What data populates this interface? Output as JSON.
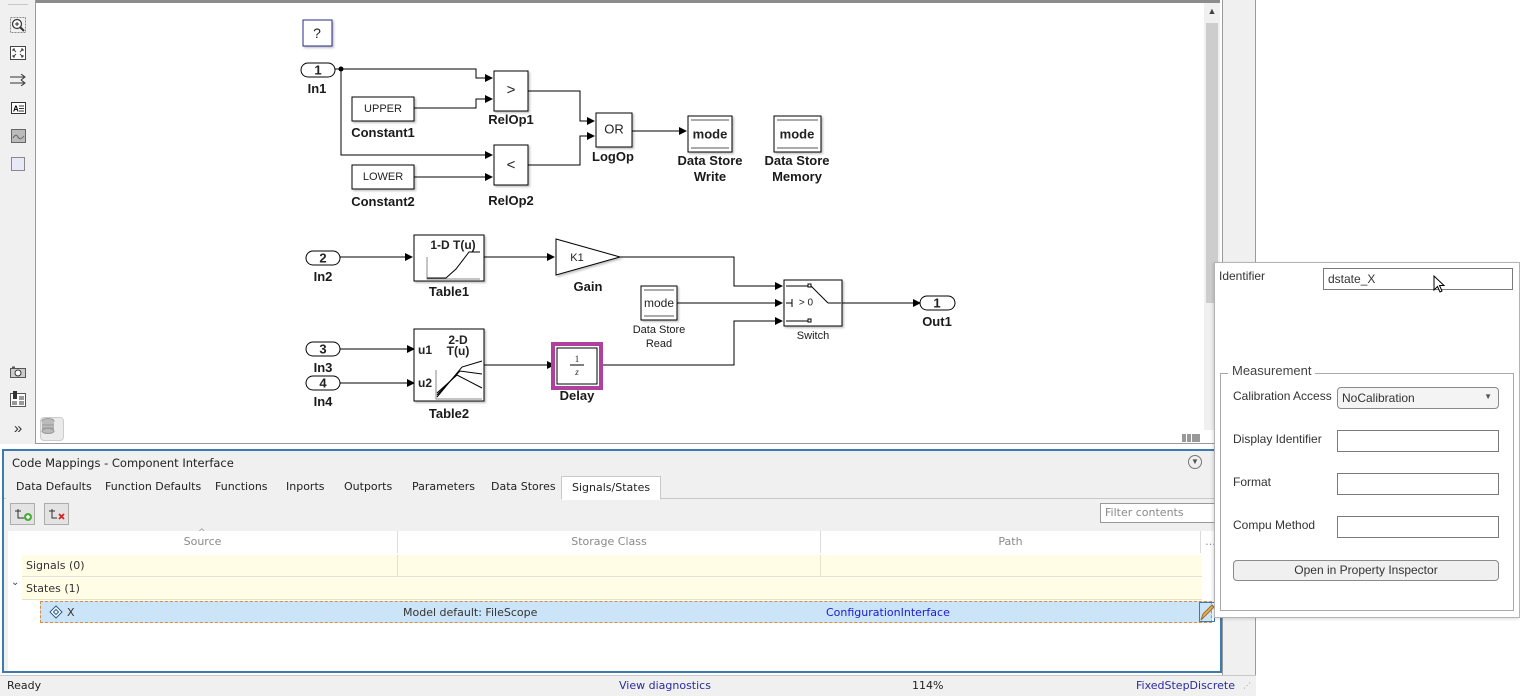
{
  "toolbar_left": {
    "icons": [
      "zoom-in-icon",
      "fit-to-view-icon",
      "route-lines-icon",
      "annotation-icon",
      "image-icon",
      "area-icon",
      "screenshot-icon",
      "property-inspector-icon",
      "more-icon"
    ]
  },
  "diagram": {
    "blocks": {
      "help": {
        "text": "?"
      },
      "in1": {
        "port": "1",
        "label": "In1"
      },
      "in2": {
        "port": "2",
        "label": "In2"
      },
      "in3": {
        "port": "3",
        "label": "In3"
      },
      "in4": {
        "port": "4",
        "label": "In4"
      },
      "out1": {
        "port": "1",
        "label": "Out1"
      },
      "constant1": {
        "text": "UPPER",
        "label": "Constant1"
      },
      "constant2": {
        "text": "LOWER",
        "label": "Constant2"
      },
      "relop1": {
        "text": ">",
        "label": "RelOp1"
      },
      "relop2": {
        "text": "<",
        "label": "RelOp2"
      },
      "logop": {
        "text": "OR",
        "label": "LogOp"
      },
      "ds_write": {
        "text": "mode",
        "label_line1": "Data Store",
        "label_line2": "Write"
      },
      "ds_memory": {
        "text": "mode",
        "label_line1": "Data Store",
        "label_line2": "Memory"
      },
      "ds_read": {
        "text": "mode",
        "label_line1": "Data Store",
        "label_line2": "Read"
      },
      "table1": {
        "text": "1-D T(u)",
        "label": "Table1"
      },
      "table2": {
        "text_line1": "2-D",
        "text_line2": "T(u)",
        "u1": "u1",
        "u2": "u2",
        "label": "Table2"
      },
      "gain": {
        "text": "K1",
        "label": "Gain"
      },
      "delay": {
        "num": "1",
        "den": "z",
        "label": "Delay"
      },
      "switch": {
        "text": "> 0",
        "label": "Switch"
      }
    }
  },
  "code_mappings": {
    "title": "Code Mappings - Component Interface",
    "tabs": [
      {
        "label": "Data Defaults",
        "active": false
      },
      {
        "label": "Function Defaults",
        "active": false
      },
      {
        "label": "Functions",
        "active": false
      },
      {
        "label": "Inports",
        "active": false
      },
      {
        "label": "Outports",
        "active": false
      },
      {
        "label": "Parameters",
        "active": false
      },
      {
        "label": "Data Stores",
        "active": false
      },
      {
        "label": "Signals/States",
        "active": true
      }
    ],
    "filter_placeholder": "Filter contents",
    "columns": [
      "Source",
      "Storage Class",
      "Path",
      "..."
    ],
    "groups": [
      {
        "label": "Signals (0)",
        "expanded": false
      },
      {
        "label": "States (1)",
        "expanded": true
      }
    ],
    "rows": [
      {
        "source": "X",
        "storage_class": "Model default: FileScope",
        "path": "ConfigurationInterface"
      }
    ]
  },
  "status_bar": {
    "state": "Ready",
    "diagnostics_link": "View diagnostics",
    "zoom": "114%",
    "solver": "FixedStepDiscrete"
  },
  "inspector_popup": {
    "identifier_label": "Identifier",
    "identifier_value": "dstate_X",
    "measurement_legend": "Measurement",
    "calibration_access_label": "Calibration Access",
    "calibration_access_value": "NoCalibration",
    "display_identifier_label": "Display Identifier",
    "display_identifier_value": "",
    "format_label": "Format",
    "format_value": "",
    "compu_method_label": "Compu Method",
    "compu_method_value": "",
    "open_button": "Open in Property Inspector"
  },
  "colors": {
    "accent": "#3d7ab0",
    "selection": "#cce4f7",
    "group_row": "#fffde6",
    "link": "#2b2b9e",
    "delay_highlight": "#b040a0"
  }
}
